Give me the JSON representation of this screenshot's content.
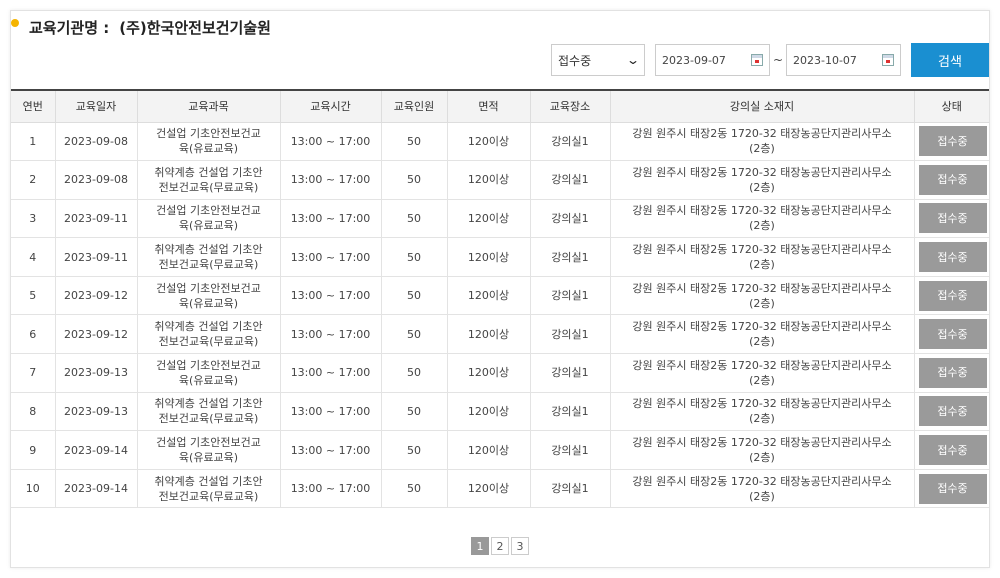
{
  "header": {
    "label": "교육기관명 :",
    "institution": "(주)한국안전보건기술원"
  },
  "filters": {
    "status_select": "접수중",
    "date_from": "2023-09-07",
    "date_separator": "~",
    "date_to": "2023-10-07",
    "search_label": "검색"
  },
  "table": {
    "columns": [
      "연번",
      "교육일자",
      "교육과목",
      "교육시간",
      "교육인원",
      "면적",
      "교육장소",
      "강의실 소재지",
      "상태"
    ],
    "rows": [
      {
        "no": "1",
        "date": "2023-09-08",
        "course_l1": "건설업 기초안전보건교",
        "course_l2": "육(유료교육)",
        "time": "13:00 ~ 17:00",
        "people": "50",
        "area": "120이상",
        "place": "강의실1",
        "addr_l1": "강원 원주시 태장2동 1720-32 태장농공단지관리사무소",
        "addr_l2": "(2층)",
        "status": "접수중"
      },
      {
        "no": "2",
        "date": "2023-09-08",
        "course_l1": "취약계층 건설업 기초안",
        "course_l2": "전보건교육(무료교육)",
        "time": "13:00 ~ 17:00",
        "people": "50",
        "area": "120이상",
        "place": "강의실1",
        "addr_l1": "강원 원주시 태장2동 1720-32 태장농공단지관리사무소",
        "addr_l2": "(2층)",
        "status": "접수중"
      },
      {
        "no": "3",
        "date": "2023-09-11",
        "course_l1": "건설업 기초안전보건교",
        "course_l2": "육(유료교육)",
        "time": "13:00 ~ 17:00",
        "people": "50",
        "area": "120이상",
        "place": "강의실1",
        "addr_l1": "강원 원주시 태장2동 1720-32 태장농공단지관리사무소",
        "addr_l2": "(2층)",
        "status": "접수중"
      },
      {
        "no": "4",
        "date": "2023-09-11",
        "course_l1": "취약계층 건설업 기초안",
        "course_l2": "전보건교육(무료교육)",
        "time": "13:00 ~ 17:00",
        "people": "50",
        "area": "120이상",
        "place": "강의실1",
        "addr_l1": "강원 원주시 태장2동 1720-32 태장농공단지관리사무소",
        "addr_l2": "(2층)",
        "status": "접수중"
      },
      {
        "no": "5",
        "date": "2023-09-12",
        "course_l1": "건설업 기초안전보건교",
        "course_l2": "육(유료교육)",
        "time": "13:00 ~ 17:00",
        "people": "50",
        "area": "120이상",
        "place": "강의실1",
        "addr_l1": "강원 원주시 태장2동 1720-32 태장농공단지관리사무소",
        "addr_l2": "(2층)",
        "status": "접수중"
      },
      {
        "no": "6",
        "date": "2023-09-12",
        "course_l1": "취약계층 건설업 기초안",
        "course_l2": "전보건교육(무료교육)",
        "time": "13:00 ~ 17:00",
        "people": "50",
        "area": "120이상",
        "place": "강의실1",
        "addr_l1": "강원 원주시 태장2동 1720-32 태장농공단지관리사무소",
        "addr_l2": "(2층)",
        "status": "접수중"
      },
      {
        "no": "7",
        "date": "2023-09-13",
        "course_l1": "건설업 기초안전보건교",
        "course_l2": "육(유료교육)",
        "time": "13:00 ~ 17:00",
        "people": "50",
        "area": "120이상",
        "place": "강의실1",
        "addr_l1": "강원 원주시 태장2동 1720-32 태장농공단지관리사무소",
        "addr_l2": "(2층)",
        "status": "접수중"
      },
      {
        "no": "8",
        "date": "2023-09-13",
        "course_l1": "취약계층 건설업 기초안",
        "course_l2": "전보건교육(무료교육)",
        "time": "13:00 ~ 17:00",
        "people": "50",
        "area": "120이상",
        "place": "강의실1",
        "addr_l1": "강원 원주시 태장2동 1720-32 태장농공단지관리사무소",
        "addr_l2": "(2층)",
        "status": "접수중"
      },
      {
        "no": "9",
        "date": "2023-09-14",
        "course_l1": "건설업 기초안전보건교",
        "course_l2": "육(유료교육)",
        "time": "13:00 ~ 17:00",
        "people": "50",
        "area": "120이상",
        "place": "강의실1",
        "addr_l1": "강원 원주시 태장2동 1720-32 태장농공단지관리사무소",
        "addr_l2": "(2층)",
        "status": "접수중"
      },
      {
        "no": "10",
        "date": "2023-09-14",
        "course_l1": "취약계층 건설업 기초안",
        "course_l2": "전보건교육(무료교육)",
        "time": "13:00 ~ 17:00",
        "people": "50",
        "area": "120이상",
        "place": "강의실1",
        "addr_l1": "강원 원주시 태장2동 1720-32 태장농공단지관리사무소",
        "addr_l2": "(2층)",
        "status": "접수중"
      }
    ]
  },
  "pagination": {
    "pages": [
      "1",
      "2",
      "3"
    ],
    "current": "1"
  },
  "colors": {
    "accent": "#1a8fd1",
    "title_dot": "#f5b400",
    "status_button": "#9a9a9a"
  }
}
